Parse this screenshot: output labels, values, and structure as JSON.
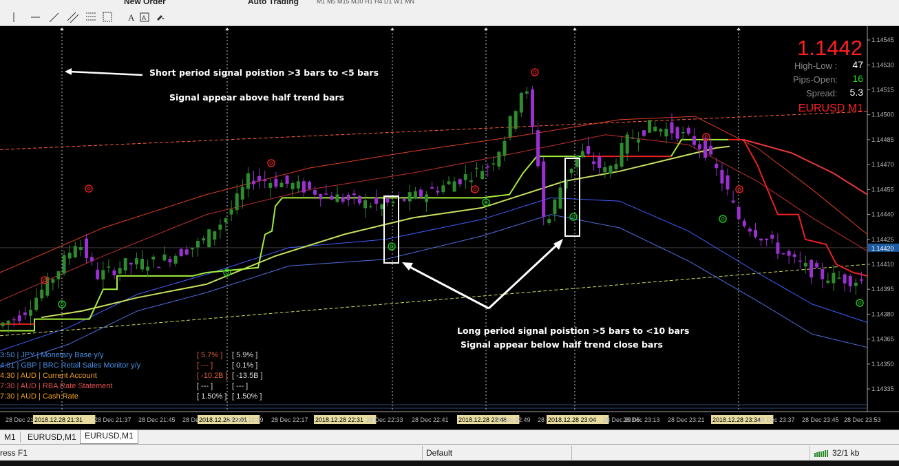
{
  "toolbar": {
    "new_order_label": "New Order",
    "auto_trading_label": "Auto Trading",
    "timeframes": [
      "M1",
      "M5",
      "M15",
      "M30",
      "H1",
      "H4",
      "D1",
      "W1",
      "MN"
    ],
    "drawing_tools": [
      "cursor-icon",
      "vertical-line-icon",
      "horizontal-line-icon",
      "trendline-icon",
      "equidistant-channel-icon",
      "fibonacci-icon",
      "text-icon",
      "text-label-icon",
      "arrows-icon"
    ],
    "text_tool_letter": "A"
  },
  "chart_data": {
    "type": "candlestick",
    "symbol": "EURUSD",
    "timeframe": "M1",
    "window_label": "EURUSD,M1",
    "price_axis": {
      "ylim": [
        1.14323,
        1.1455
      ],
      "ticks": [
        "1.14545",
        "1.14530",
        "1.14515",
        "1.14500",
        "1.14485",
        "1.14470",
        "1.14455",
        "1.14440",
        "1.14425",
        "1.14410",
        "1.14395",
        "1.14380",
        "1.14365",
        "1.14350",
        "1.14335"
      ],
      "current_price_label": "1.14420"
    },
    "time_axis": {
      "labels": [
        "28 Dec 21:29",
        "2018.12.28 21:31",
        "28 Dec 21:37",
        "28 Dec 21:45",
        "28 Dec 21:53",
        "2018.12.28 22:01",
        "28 Dec 22:09",
        "28 Dec 22:17",
        "2018.12.28 22:31",
        "28 Dec 22:33",
        "28 Dec 22:41",
        "2018.12.28 22:48",
        "28 Dec 22:49",
        "28 Dec 22:57",
        "2018.12.28 23:04",
        "28 Dec 23:05",
        "28 Dec 23:13",
        "28 Dec 23:21",
        "2018.12.28 23:34",
        "28 Dec 23:37",
        "28 Dec 23:45",
        "28 Dec 23:53"
      ],
      "highlighted": [
        "2018.12.28 21:31",
        "2018.12.28 22:01",
        "2018.12.28 22:31",
        "2018.12.28 22:48",
        "2018.12.28 23:04",
        "2018.12.28 23:34"
      ]
    },
    "info_panel": {
      "price": "1.1442",
      "high_low_label": "High-Low :",
      "high_low_value": "47",
      "pips_open_label": "Pips-Open:",
      "pips_open_value": "16",
      "spread_label": "Spread:",
      "spread_value": "5.3",
      "symbol_tf": "EURUSD  M1"
    },
    "news": [
      {
        "time": "3:50",
        "currency": "JPY",
        "event": "Monetary Base y/y",
        "actual": "[ 5.7% ]",
        "previous": "[ 5.9% ]",
        "color": "#4a90e2",
        "actual_color": "#e06030"
      },
      {
        "time": "4:01",
        "currency": "GBP",
        "event": "BRC Retail Sales Monitor y/y",
        "actual": "[ --- ]",
        "previous": "[ 0.1% ]",
        "color": "#4a90e2",
        "actual_color": "#e06030"
      },
      {
        "time": "4:30",
        "currency": "AUD",
        "event": "Current Account",
        "actual": "[ -10.2B ]",
        "previous": "[ -13.5B ]",
        "color": "#f0a020",
        "actual_color": "#e06030"
      },
      {
        "time": "7:30",
        "currency": "AUD",
        "event": "RBA Rate Statement",
        "actual": "[ --- ]",
        "previous": "[ --- ]",
        "color": "#e05050",
        "actual_color": "#dddddd"
      },
      {
        "time": "7:30",
        "currency": "AUD",
        "event": "Cash Rate",
        "actual": "[ 1.50% ]",
        "previous": "[ 1.50% ]",
        "color": "#f0a020",
        "actual_color": "#dddddd"
      }
    ],
    "annotations": {
      "short_1": "Short period signal poistion >3 bars to <5 bars",
      "short_2": "Signal appear above half trend bars",
      "long_1": "Long period signal poistion >5 bars to <10 bars",
      "long_2": "Signal appear below half trend close bars"
    },
    "series_colors": {
      "bull_candle": "#2e8b2e",
      "bear_candle": "#9b30d0",
      "half_trend_up": "#a6ee3c",
      "half_trend_down": "#ee2020",
      "ma_fast": "#c8e060",
      "ma_lower": "#4060ff",
      "ma_lower2": "#5070e0",
      "ma_upper": "#e04020",
      "ma_upper2": "#c03030",
      "dash_upper": "#ff6040",
      "dash_lower": "#d8e060",
      "buy_signal": "#20c020",
      "sell_signal": "#e02020",
      "price_big": "#ff2020"
    }
  },
  "tabs": [
    "M1",
    "EURUSD,M1",
    "EURUSD,M1"
  ],
  "status": {
    "help": "ress F1",
    "profile": "Default",
    "traffic": "32/1 kb"
  }
}
